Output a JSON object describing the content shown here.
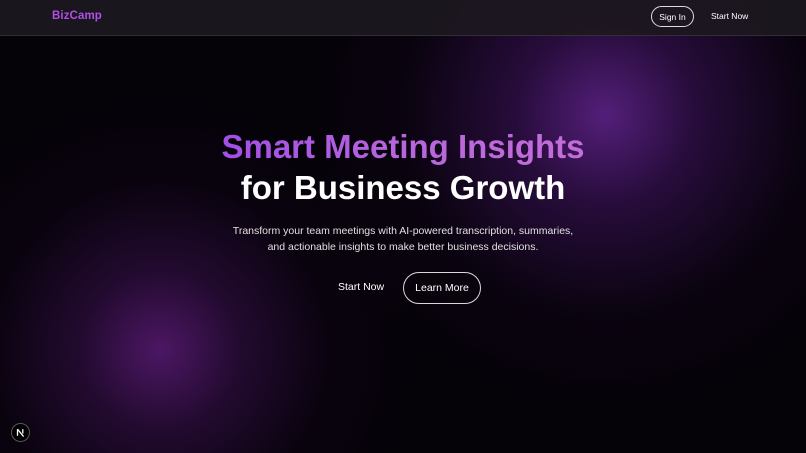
{
  "navbar": {
    "brand": "BizCamp",
    "sign_in_label": "Sign In",
    "start_now_label": "Start Now"
  },
  "hero": {
    "headline_line1": "Smart Meeting Insights",
    "headline_line2": "for Business Growth",
    "subtitle": "Transform your team meetings with AI-powered transcription, summaries, and actionable insights to make better business decisions.",
    "primary_cta_label": "Start Now",
    "secondary_cta_label": "Learn More"
  },
  "badge": {
    "icon": "nextjs-logo-icon"
  },
  "colors": {
    "accent": "#b24ee8",
    "background": "#050208",
    "glow": "#6e28a0"
  }
}
